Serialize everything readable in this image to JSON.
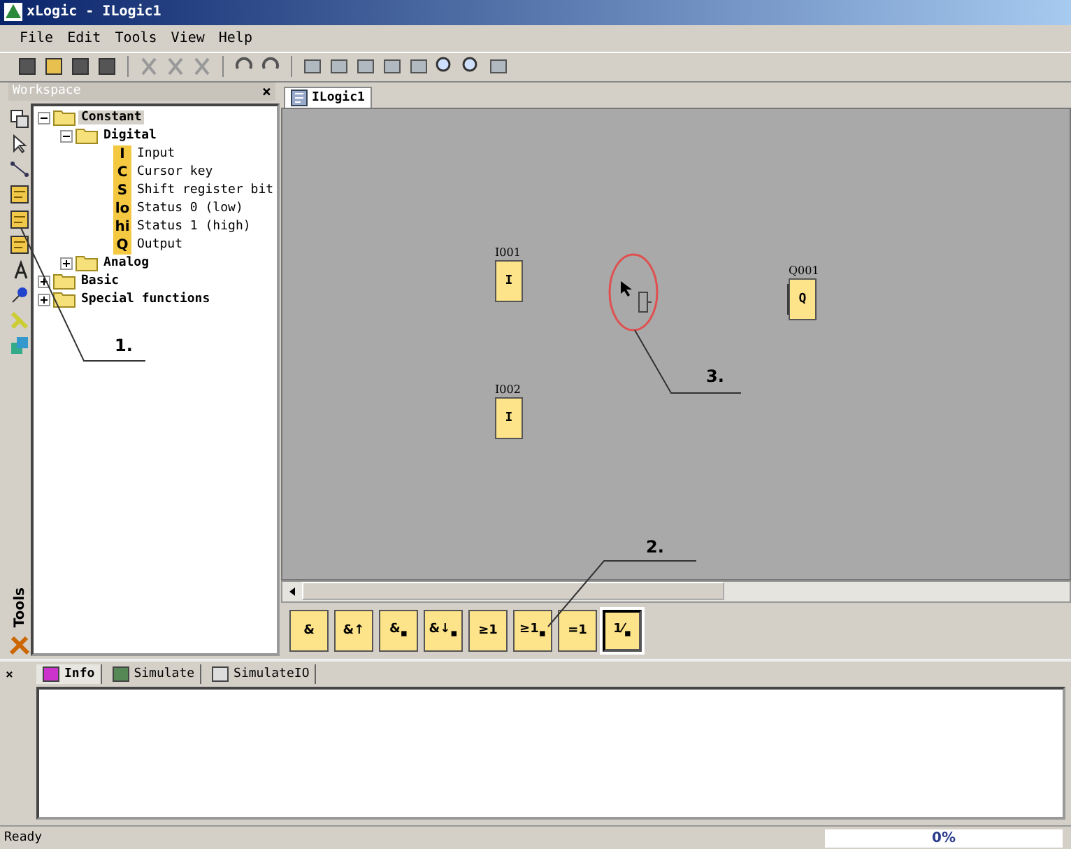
{
  "window": {
    "title": "xLogic - ILogic1"
  },
  "menu": [
    "File",
    "Edit",
    "Tools",
    "View",
    "Help"
  ],
  "workspace": {
    "title": "Workspace",
    "close": "×",
    "tools_label": "Tools",
    "tree": [
      {
        "label": "Constant",
        "kind": "folder",
        "expanded": true,
        "selected": true,
        "children": [
          {
            "label": "Digital",
            "kind": "folder",
            "expanded": true,
            "selected": false,
            "children": [
              {
                "label": "Input",
                "kind": "leaf",
                "symbol": "I",
                "selected": false
              },
              {
                "label": "Cursor key",
                "kind": "leaf",
                "symbol": "C",
                "selected": false
              },
              {
                "label": "Shift register bit",
                "kind": "leaf",
                "symbol": "S",
                "selected": false
              },
              {
                "label": "Status 0 (low)",
                "kind": "leaf",
                "symbol": "lo",
                "selected": false
              },
              {
                "label": "Status 1 (high)",
                "kind": "leaf",
                "symbol": "hi",
                "selected": false
              },
              {
                "label": "Output",
                "kind": "leaf",
                "symbol": "Q",
                "selected": false
              }
            ]
          },
          {
            "label": "Analog",
            "kind": "folder",
            "expanded": false,
            "selected": false
          }
        ]
      },
      {
        "label": "Basic",
        "kind": "folder",
        "expanded": false,
        "selected": false
      },
      {
        "label": "Special functions",
        "kind": "folder",
        "expanded": false,
        "selected": false
      }
    ]
  },
  "editor": {
    "tabs": [
      {
        "label": "ILogic1",
        "selected": true
      }
    ],
    "blocks": [
      {
        "name": "I001",
        "symbol": "I",
        "kind": "input"
      },
      {
        "name": "I002",
        "symbol": "I",
        "kind": "input"
      },
      {
        "name": "Q001",
        "symbol": "Q",
        "kind": "output"
      }
    ],
    "palette": [
      {
        "symbol": "&",
        "selected": false
      },
      {
        "symbol": "&↑",
        "selected": false
      },
      {
        "symbol": "&$_{▪}$",
        "selected": false
      },
      {
        "symbol": "&↓$_{▪}$",
        "selected": false
      },
      {
        "symbol": "≥1",
        "selected": false
      },
      {
        "symbol": "≥1$_{▪}$",
        "selected": false
      },
      {
        "symbol": "=1",
        "selected": false
      },
      {
        "symbol": "1⁄$_{▪}$",
        "selected": true
      }
    ]
  },
  "annotations": [
    {
      "label": "1."
    },
    {
      "label": "2."
    },
    {
      "label": "3."
    }
  ],
  "output_panel": {
    "close": "×",
    "tabs": [
      {
        "label": "Info",
        "selected": true
      },
      {
        "label": "Simulate",
        "selected": false
      },
      {
        "label": "SimulateIO",
        "selected": false
      }
    ]
  },
  "status_bar": {
    "text": "Ready",
    "progress": {
      "level": 0,
      "reading": "0%"
    }
  }
}
